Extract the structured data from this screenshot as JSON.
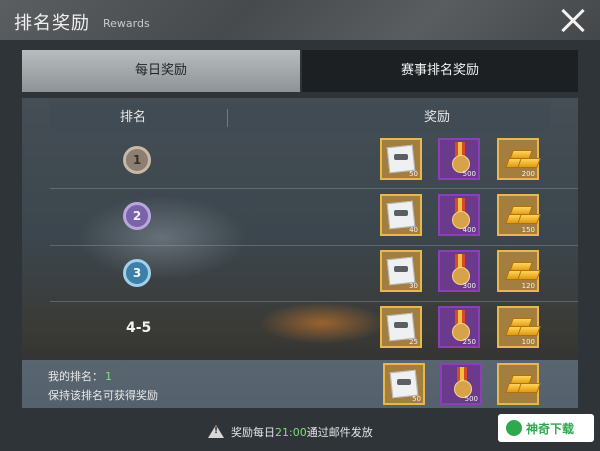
{
  "header": {
    "title": "排名奖励",
    "subtitle": "Rewards"
  },
  "tabs": [
    {
      "label": "每日奖励",
      "active": true
    },
    {
      "label": "赛事排名奖励",
      "active": false
    }
  ],
  "table": {
    "col_rank": "排名",
    "col_reward": "奖励"
  },
  "rows": [
    {
      "rank_label": "1",
      "rewards": [
        "50",
        "500",
        "200"
      ]
    },
    {
      "rank_label": "2",
      "rewards": [
        "40",
        "400",
        "150"
      ]
    },
    {
      "rank_label": "3",
      "rewards": [
        "30",
        "300",
        "120"
      ]
    },
    {
      "rank_label": "4-5",
      "rewards": [
        "25",
        "250",
        "100"
      ]
    }
  ],
  "my_rank": {
    "label": "我的排名：",
    "value": "1",
    "hint": "保持该排名可获得奖励",
    "rewards": [
      "50",
      "500",
      ""
    ]
  },
  "notice": {
    "prefix": "奖励每日",
    "time": "21:00",
    "suffix": "通过邮件发放"
  },
  "watermark": {
    "text": "神奇下载"
  },
  "colors": {
    "accent_green": "#7ee07a",
    "gold_border": "#e8b84a",
    "medal_bg": "#6b3a8c"
  },
  "icons": [
    "close-icon",
    "rank-badge-icon",
    "paper-item-icon",
    "medal-item-icon",
    "gold-item-icon",
    "warning-icon"
  ]
}
